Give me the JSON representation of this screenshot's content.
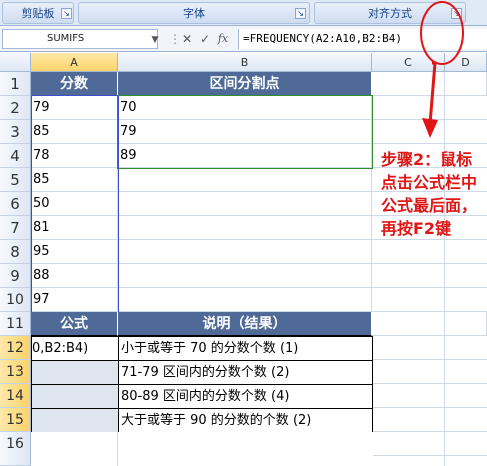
{
  "ribbon": {
    "groups": [
      {
        "label": "剪贴板"
      },
      {
        "label": "字体"
      },
      {
        "label": "对齐方式"
      }
    ],
    "launcher_glyph": "↘"
  },
  "formula_bar": {
    "name_box": "SUMIFS",
    "formula": "=FREQUENCY(A2:A10,B2:B4)",
    "fx_label": "fx"
  },
  "columns": [
    "A",
    "B",
    "C",
    "D"
  ],
  "rows": [
    "1",
    "2",
    "3",
    "4",
    "5",
    "6",
    "7",
    "8",
    "9",
    "10",
    "11",
    "12",
    "13",
    "14",
    "15",
    "16"
  ],
  "sheet": {
    "header_a": "分数",
    "header_b": "区间分割点",
    "scores": [
      "79",
      "85",
      "78",
      "85",
      "50",
      "81",
      "95",
      "88",
      "97"
    ],
    "breakpoints": [
      "70",
      "79",
      "89"
    ],
    "header_formula": "公式",
    "header_desc": "说明（结果）",
    "a12": "0,B2:B4)",
    "descriptions": [
      "小于或等于 70 的分数个数 (1)",
      "71-79 区间内的分数个数 (2)",
      "80-89 区间内的分数个数 (4)",
      "大于或等于 90 的分数的个数 (2)"
    ]
  },
  "annotation": {
    "text": "步骤2：鼠标点击公式栏中公式最后面，再按F2键",
    "color": "#e01616"
  },
  "colors": {
    "header_fill": "#4f6a96",
    "shaded_fill": "#dfe5ee",
    "accent_red": "#e01616"
  }
}
